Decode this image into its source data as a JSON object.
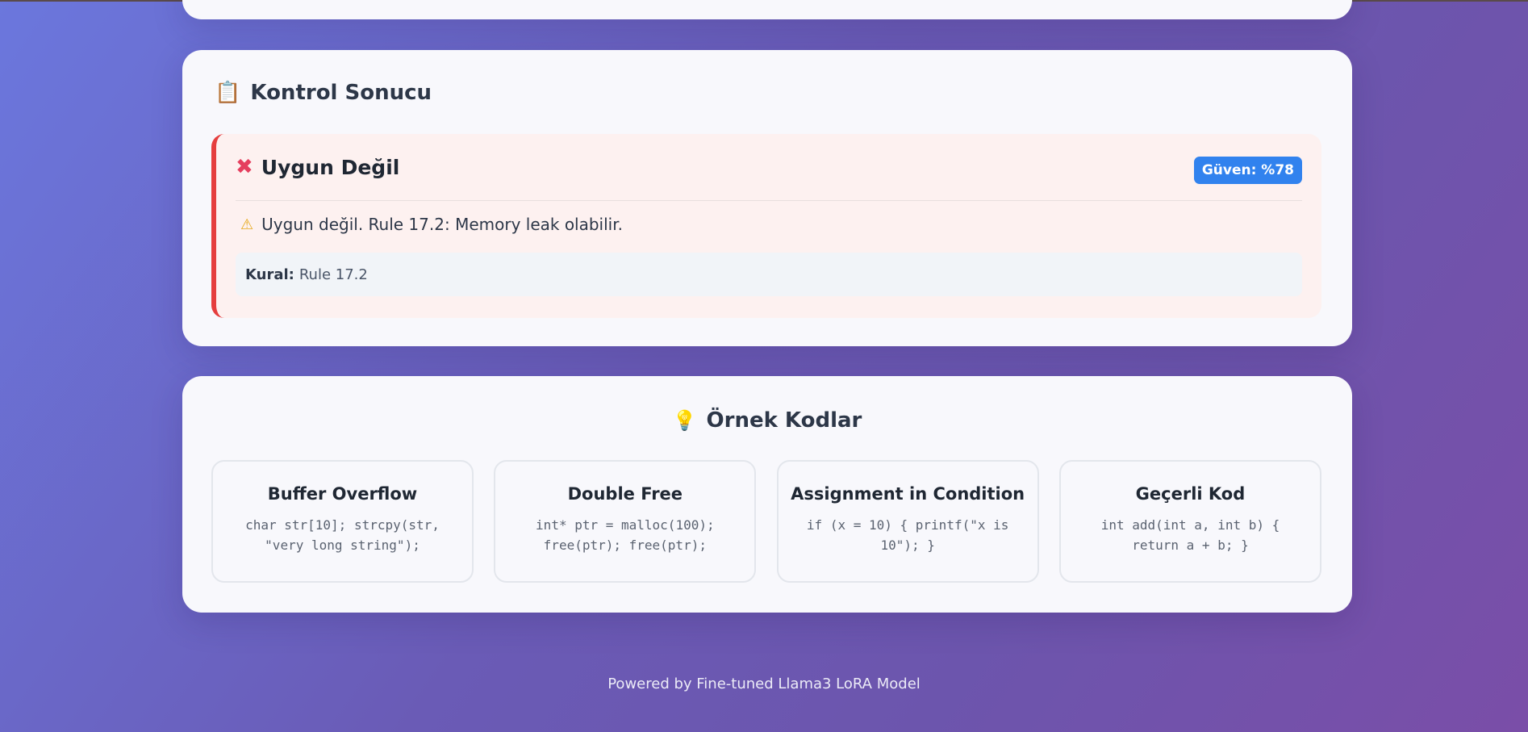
{
  "result": {
    "title": "Kontrol Sonucu",
    "title_icon": "clipboard-icon",
    "status_label": "Uygun Değil",
    "status_icon": "x-mark-icon",
    "confidence_badge": "Güven: %78",
    "message": "Uygun değil. Rule 17.2: Memory leak olabilir.",
    "message_icon": "warning-icon",
    "rule_label": "Kural:",
    "rule_value": "Rule 17.2",
    "accent_color": "#e53e3e",
    "badge_color": "#3182ee"
  },
  "examples": {
    "title": "Örnek Kodlar",
    "title_icon": "lightbulb-icon",
    "items": [
      {
        "title": "Buffer Overflow",
        "code": "char str[10]; strcpy(str, \"very long string\");"
      },
      {
        "title": "Double Free",
        "code": "int* ptr = malloc(100); free(ptr); free(ptr);"
      },
      {
        "title": "Assignment in Condition",
        "code": "if (x = 10) { printf(\"x is 10\"); }"
      },
      {
        "title": "Geçerli Kod",
        "code": "int add(int a, int b) { return a + b; }"
      }
    ]
  },
  "footer": {
    "text": "Powered by Fine-tuned Llama3 LoRA Model"
  }
}
